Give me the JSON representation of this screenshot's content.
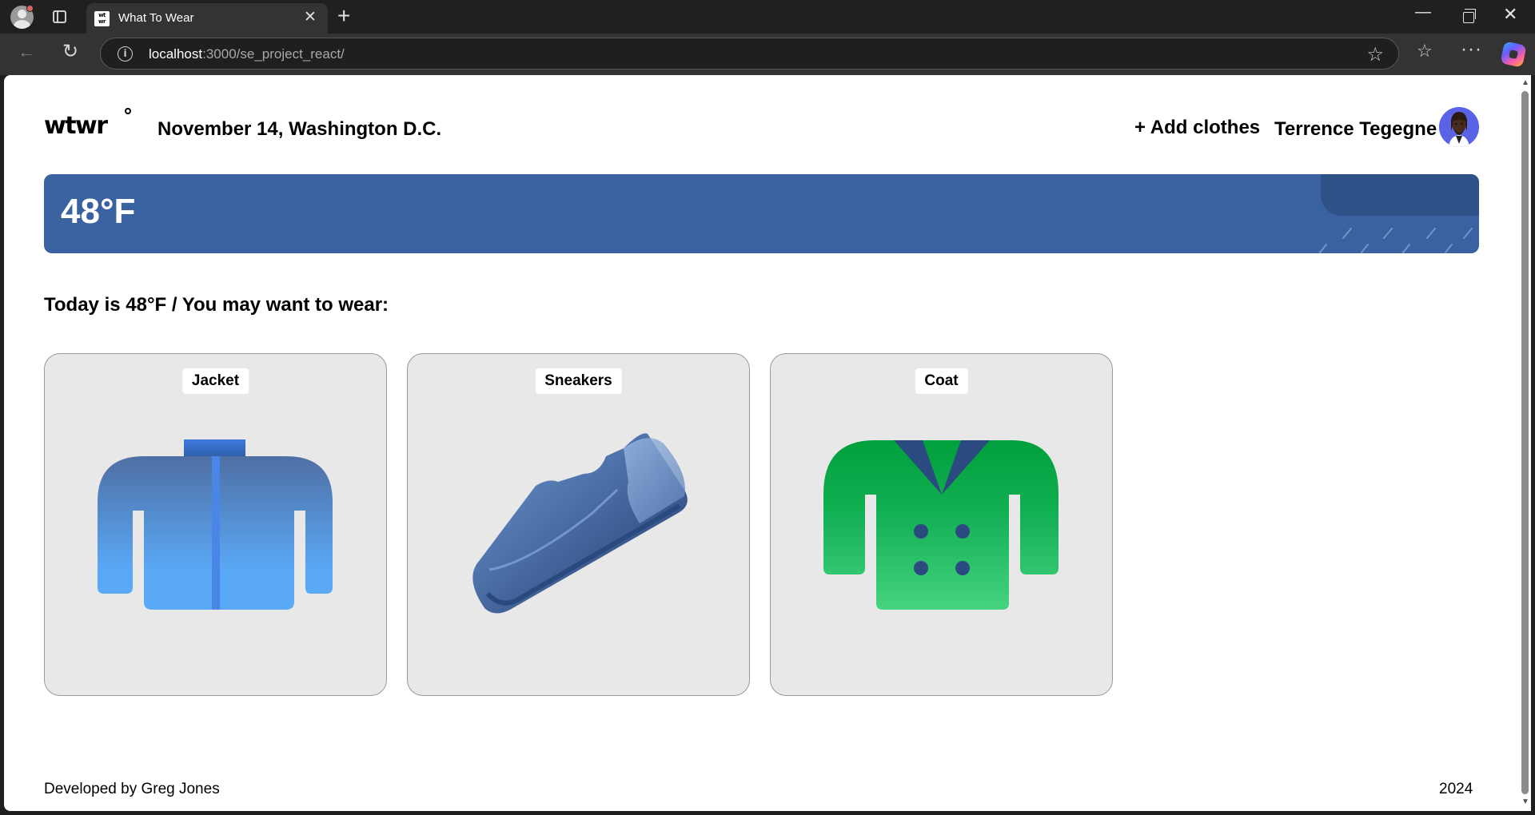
{
  "browser": {
    "tab_title": "What To Wear",
    "favicon_text": "wt wr",
    "url_host": "localhost",
    "url_path": ":3000/se_project_react/",
    "icons": [
      "profile-icon",
      "tabs-icon",
      "close-icon",
      "new-tab-icon",
      "minimize-icon",
      "maximize-icon",
      "window-close-icon",
      "back-icon",
      "reload-icon",
      "info-icon",
      "star-icon",
      "favorites-icon",
      "more-icon",
      "copilot-icon"
    ]
  },
  "header": {
    "logo": "wtwr",
    "date_location": "November 14, Washington D.C.",
    "add_clothes": "+ Add clothes",
    "username": "Terrence Tegegne"
  },
  "weather": {
    "temperature": "48°F",
    "banner_color": "#3b62a0",
    "condition_icons": [
      "cloud-icon",
      "rain-icon"
    ]
  },
  "main": {
    "suggestion": "Today is 48°F / You may want to wear:",
    "items": [
      {
        "name": "Jacket",
        "icon": "jacket-icon"
      },
      {
        "name": "Sneakers",
        "icon": "sneakers-icon"
      },
      {
        "name": "Coat",
        "icon": "coat-icon"
      }
    ]
  },
  "footer": {
    "developer": "Developed by Greg Jones",
    "year": "2024"
  }
}
